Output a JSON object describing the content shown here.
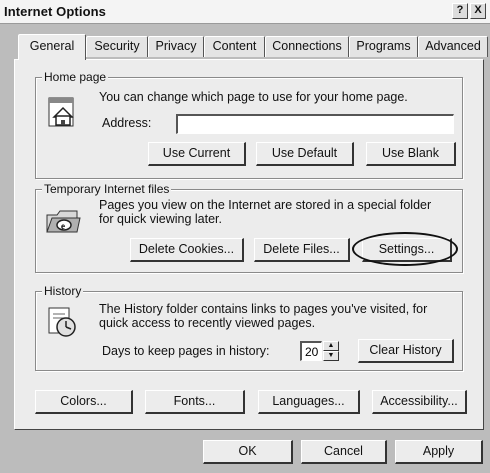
{
  "window": {
    "title": "Internet Options",
    "help_glyph": "?",
    "close_glyph": "X"
  },
  "tabs": [
    {
      "label": "General"
    },
    {
      "label": "Security"
    },
    {
      "label": "Privacy"
    },
    {
      "label": "Content"
    },
    {
      "label": "Connections"
    },
    {
      "label": "Programs"
    },
    {
      "label": "Advanced"
    }
  ],
  "home_page": {
    "legend": "Home page",
    "description": "You can change which page to use for your home page.",
    "address_label": "Address:",
    "address_value": "",
    "buttons": {
      "use_current": "Use Current",
      "use_default": "Use Default",
      "use_blank": "Use Blank"
    }
  },
  "temp_files": {
    "legend": "Temporary Internet files",
    "description_line1": "Pages you view on the Internet are stored in a special folder",
    "description_line2": "for quick viewing later.",
    "buttons": {
      "delete_cookies": "Delete Cookies...",
      "delete_files": "Delete Files...",
      "settings": "Settings..."
    }
  },
  "history": {
    "legend": "History",
    "description_line1": "The History folder contains links to pages you've visited, for",
    "description_line2": "quick access to recently viewed pages.",
    "days_label": "Days to keep pages in history:",
    "days_value": "20",
    "spin_up": "▲",
    "spin_down": "▼",
    "clear_button": "Clear History"
  },
  "bottom_buttons": {
    "colors": "Colors...",
    "fonts": "Fonts...",
    "languages": "Languages...",
    "accessibility": "Accessibility..."
  },
  "dialog_buttons": {
    "ok": "OK",
    "cancel": "Cancel",
    "apply": "Apply"
  },
  "icons": {
    "home_page": "house-page-icon",
    "temp_files": "ie-folder-icon",
    "history": "history-clock-icon"
  }
}
